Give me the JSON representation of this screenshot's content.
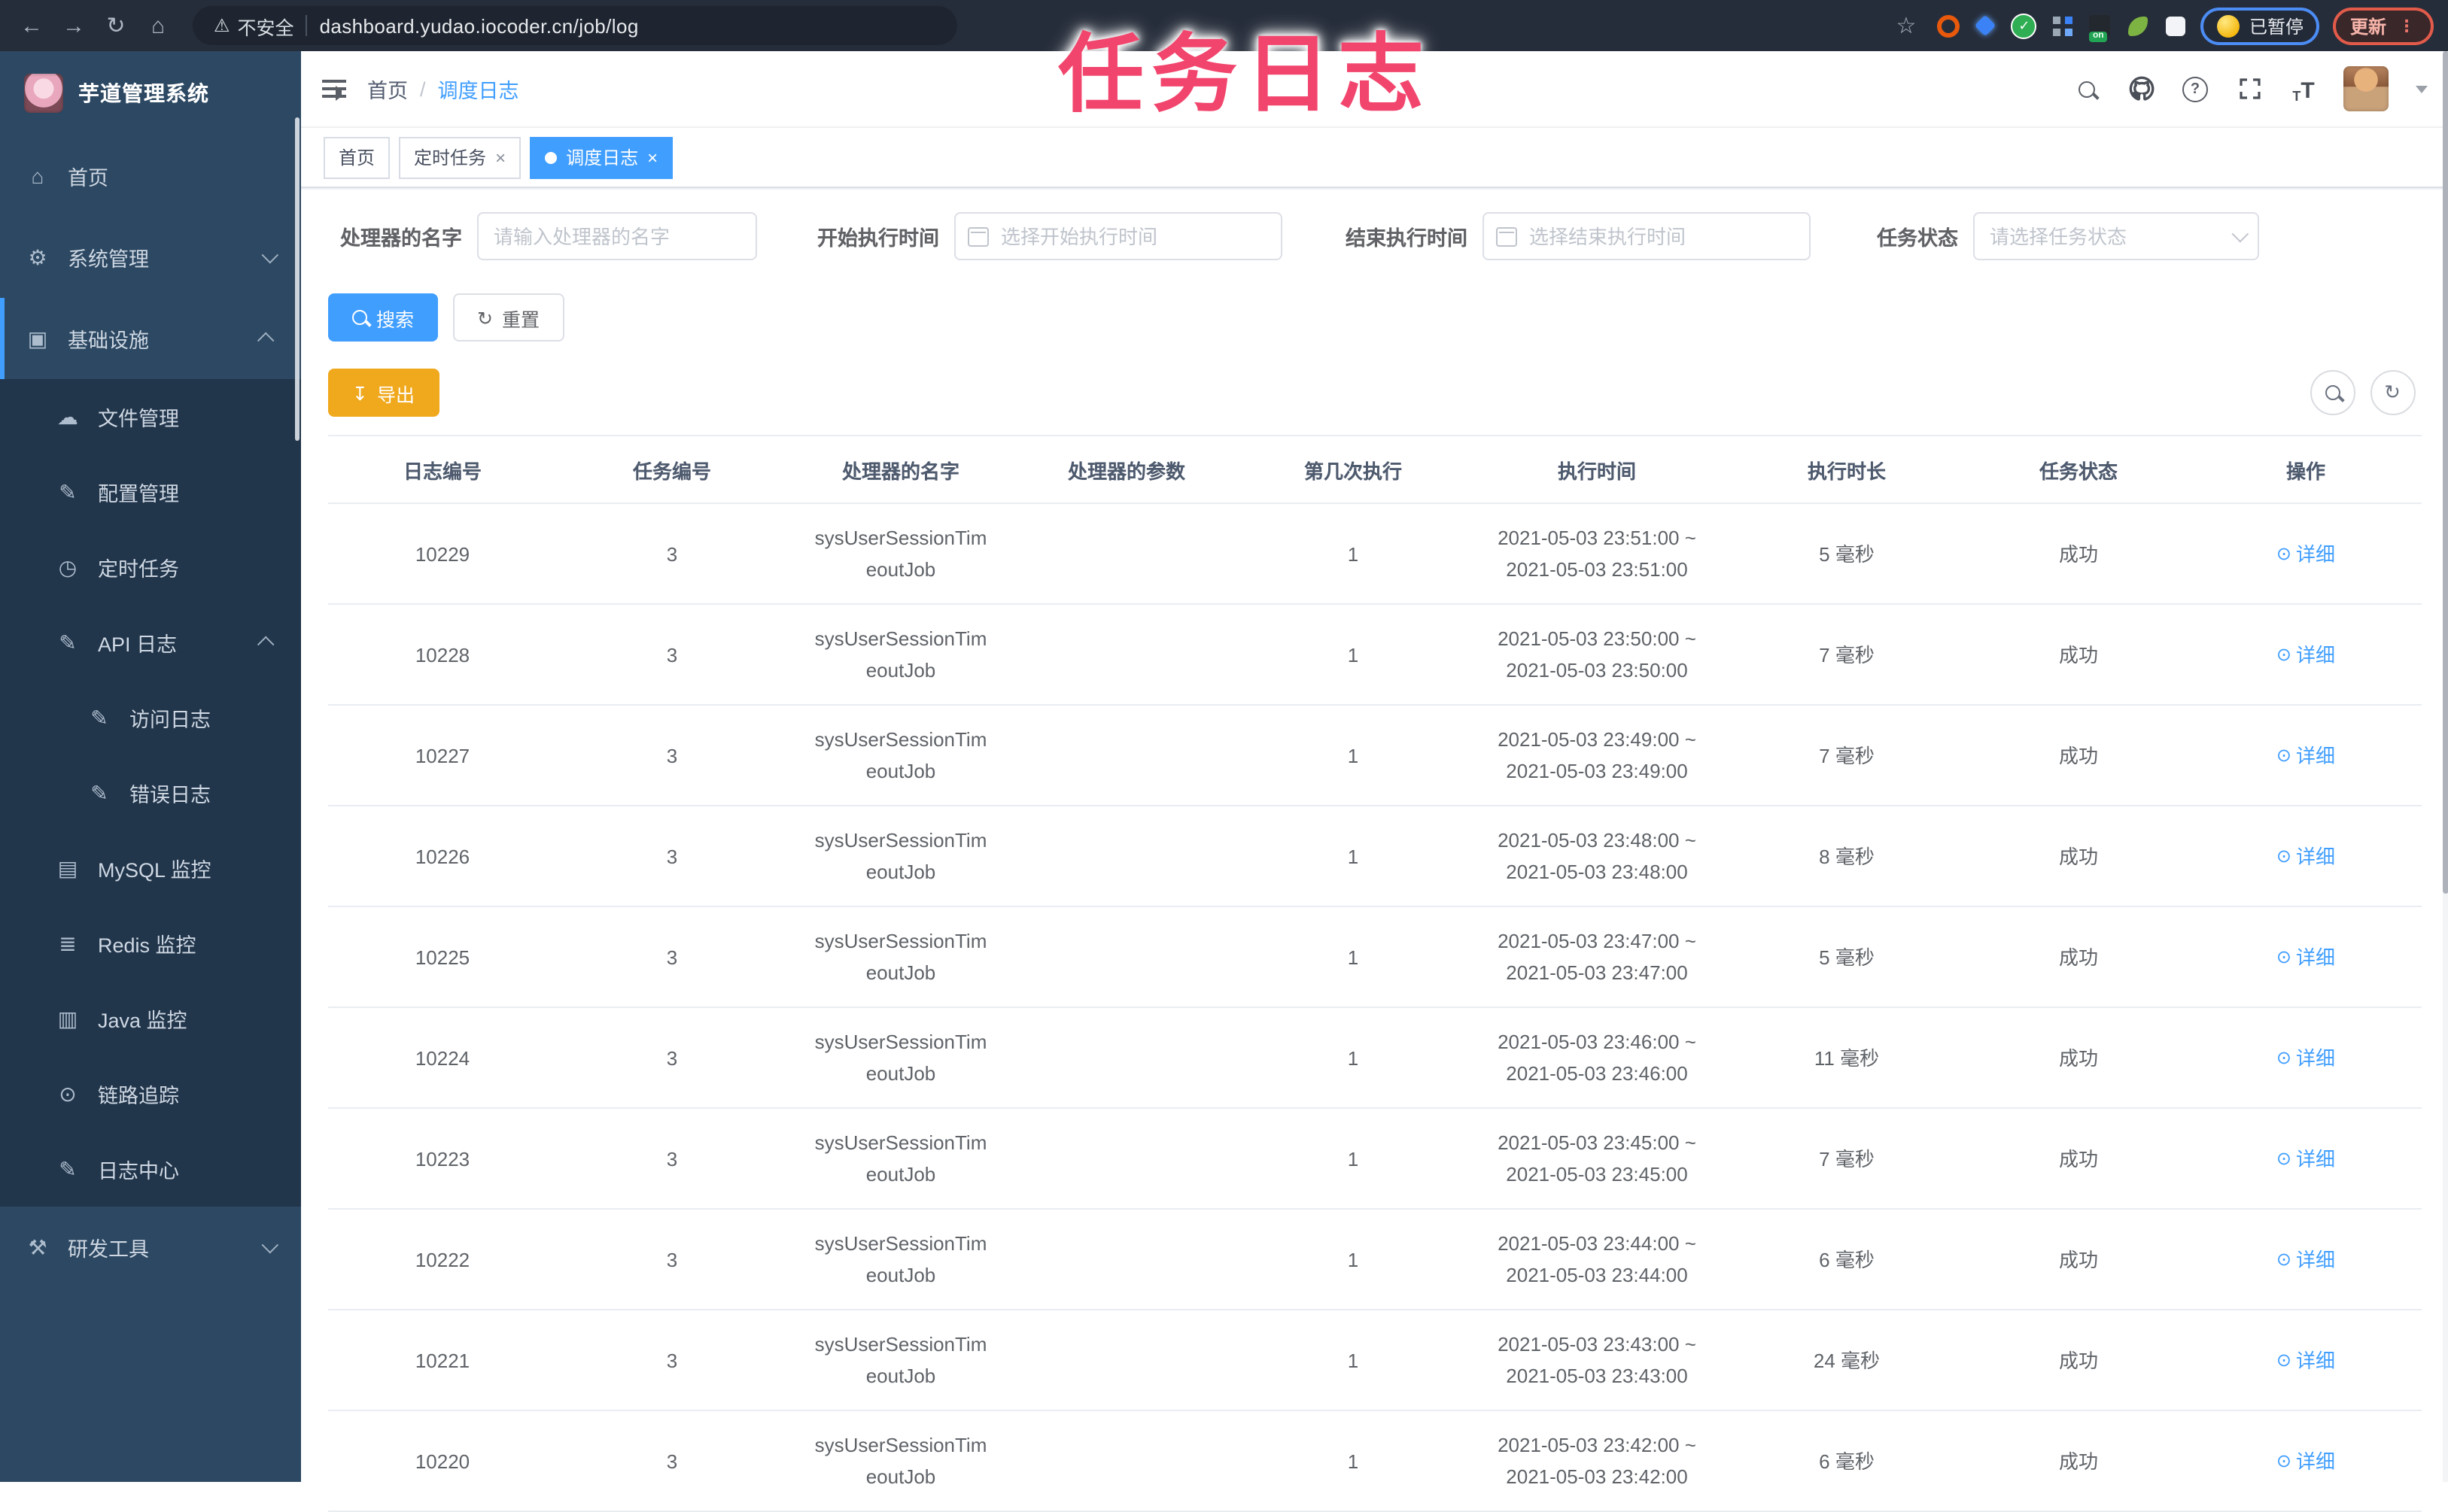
{
  "colors": {
    "accent_blue": "#409eff",
    "warning_orange": "#f0a81c",
    "overlay_red": "#f2456d",
    "sidebar_bg": "#2c4862",
    "sidebar_submenu_bg": "#21354b",
    "browser_bar_bg": "#262d3a"
  },
  "overlay": {
    "title": "任务日志"
  },
  "browser": {
    "security_label": "不安全",
    "url": "dashboard.yudao.iocoder.cn/job/log",
    "profile_badge": "已暂停",
    "update_label": "更新"
  },
  "sidebar": {
    "title": "芋道管理系统",
    "items": [
      {
        "icon": "dashboard",
        "label": "首页"
      },
      {
        "icon": "gear",
        "label": "系统管理"
      },
      {
        "icon": "monitor",
        "label": "基础设施"
      },
      {
        "icon": "cloud-upload",
        "label": "文件管理"
      },
      {
        "icon": "edit",
        "label": "配置管理"
      },
      {
        "icon": "clock",
        "label": "定时任务"
      },
      {
        "icon": "edit",
        "label": "API 日志"
      },
      {
        "icon": "edit",
        "label": "访问日志"
      },
      {
        "icon": "edit",
        "label": "错误日志"
      },
      {
        "icon": "grid",
        "label": "MySQL 监控"
      },
      {
        "icon": "layers",
        "label": "Redis 监控"
      },
      {
        "icon": "screen",
        "label": "Java 监控"
      },
      {
        "icon": "eye",
        "label": "链路追踪"
      },
      {
        "icon": "edit",
        "label": "日志中心"
      },
      {
        "icon": "toolbox",
        "label": "研发工具"
      }
    ]
  },
  "header": {
    "breadcrumb_home": "首页",
    "breadcrumb_current": "调度日志"
  },
  "tabs": [
    {
      "label": "首页",
      "closable": false,
      "active": false
    },
    {
      "label": "定时任务",
      "closable": true,
      "active": false
    },
    {
      "label": "调度日志",
      "closable": true,
      "active": true
    }
  ],
  "filters": {
    "handler_label": "处理器的名字",
    "handler_placeholder": "请输入处理器的名字",
    "start_label": "开始执行时间",
    "start_placeholder": "选择开始执行时间",
    "end_label": "结束执行时间",
    "end_placeholder": "选择结束执行时间",
    "status_label": "任务状态",
    "status_placeholder": "请选择任务状态"
  },
  "actions": {
    "search": "搜索",
    "reset": "重置",
    "export": "导出"
  },
  "table": {
    "columns": [
      "日志编号",
      "任务编号",
      "处理器的名字",
      "处理器的参数",
      "第几次执行",
      "执行时间",
      "执行时长",
      "任务状态",
      "操作"
    ],
    "rows": [
      {
        "log_id": "10229",
        "task_id": "3",
        "handler_line1": "sysUserSessionTim",
        "handler_line2": "eoutJob",
        "param": "",
        "execute_index": "1",
        "time_start": "2021-05-03 23:51:00 ~",
        "time_end": "2021-05-03 23:51:00",
        "duration": "5 毫秒",
        "status": "成功",
        "action": "详细"
      },
      {
        "log_id": "10228",
        "task_id": "3",
        "handler_line1": "sysUserSessionTim",
        "handler_line2": "eoutJob",
        "param": "",
        "execute_index": "1",
        "time_start": "2021-05-03 23:50:00 ~",
        "time_end": "2021-05-03 23:50:00",
        "duration": "7 毫秒",
        "status": "成功",
        "action": "详细"
      },
      {
        "log_id": "10227",
        "task_id": "3",
        "handler_line1": "sysUserSessionTim",
        "handler_line2": "eoutJob",
        "param": "",
        "execute_index": "1",
        "time_start": "2021-05-03 23:49:00 ~",
        "time_end": "2021-05-03 23:49:00",
        "duration": "7 毫秒",
        "status": "成功",
        "action": "详细"
      },
      {
        "log_id": "10226",
        "task_id": "3",
        "handler_line1": "sysUserSessionTim",
        "handler_line2": "eoutJob",
        "param": "",
        "execute_index": "1",
        "time_start": "2021-05-03 23:48:00 ~",
        "time_end": "2021-05-03 23:48:00",
        "duration": "8 毫秒",
        "status": "成功",
        "action": "详细"
      },
      {
        "log_id": "10225",
        "task_id": "3",
        "handler_line1": "sysUserSessionTim",
        "handler_line2": "eoutJob",
        "param": "",
        "execute_index": "1",
        "time_start": "2021-05-03 23:47:00 ~",
        "time_end": "2021-05-03 23:47:00",
        "duration": "5 毫秒",
        "status": "成功",
        "action": "详细"
      },
      {
        "log_id": "10224",
        "task_id": "3",
        "handler_line1": "sysUserSessionTim",
        "handler_line2": "eoutJob",
        "param": "",
        "execute_index": "1",
        "time_start": "2021-05-03 23:46:00 ~",
        "time_end": "2021-05-03 23:46:00",
        "duration": "11 毫秒",
        "status": "成功",
        "action": "详细"
      },
      {
        "log_id": "10223",
        "task_id": "3",
        "handler_line1": "sysUserSessionTim",
        "handler_line2": "eoutJob",
        "param": "",
        "execute_index": "1",
        "time_start": "2021-05-03 23:45:00 ~",
        "time_end": "2021-05-03 23:45:00",
        "duration": "7 毫秒",
        "status": "成功",
        "action": "详细"
      },
      {
        "log_id": "10222",
        "task_id": "3",
        "handler_line1": "sysUserSessionTim",
        "handler_line2": "eoutJob",
        "param": "",
        "execute_index": "1",
        "time_start": "2021-05-03 23:44:00 ~",
        "time_end": "2021-05-03 23:44:00",
        "duration": "6 毫秒",
        "status": "成功",
        "action": "详细"
      },
      {
        "log_id": "10221",
        "task_id": "3",
        "handler_line1": "sysUserSessionTim",
        "handler_line2": "eoutJob",
        "param": "",
        "execute_index": "1",
        "time_start": "2021-05-03 23:43:00 ~",
        "time_end": "2021-05-03 23:43:00",
        "duration": "24 毫秒",
        "status": "成功",
        "action": "详细"
      },
      {
        "log_id": "10220",
        "task_id": "3",
        "handler_line1": "sysUserSessionTim",
        "handler_line2": "eoutJob",
        "param": "",
        "execute_index": "1",
        "time_start": "2021-05-03 23:42:00 ~",
        "time_end": "2021-05-03 23:42:00",
        "duration": "6 毫秒",
        "status": "成功",
        "action": "详细"
      }
    ]
  }
}
